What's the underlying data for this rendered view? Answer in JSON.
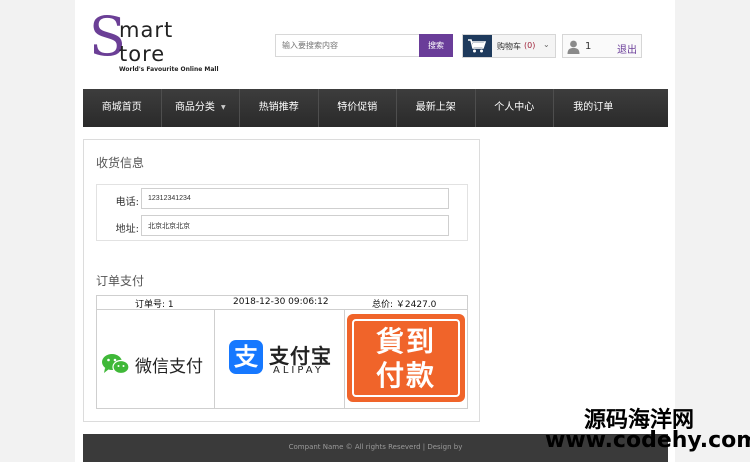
{
  "logo": {
    "s_letter": "S",
    "line1": "mart",
    "line2": "tore",
    "tagline": "World's Favourite Online Mall"
  },
  "search": {
    "placeholder": "输入要搜索内容",
    "button_label": "搜索"
  },
  "cart": {
    "label": "购物车",
    "count": "(0)",
    "icon": "cart-icon"
  },
  "user": {
    "icon": "user-icon",
    "id": "1",
    "logout_label": "退出"
  },
  "nav": {
    "items": [
      {
        "label": "商城首页"
      },
      {
        "label": "商品分类"
      },
      {
        "label": "热销推荐"
      },
      {
        "label": "特价促销"
      },
      {
        "label": "最新上架"
      },
      {
        "label": "个人中心"
      },
      {
        "label": "我的订单"
      }
    ]
  },
  "shipping": {
    "title": "收货信息",
    "phone_label": "电话:",
    "phone_value": "12312341234",
    "address_label": "地址:",
    "address_value": "北京北京北京"
  },
  "payment": {
    "title": "订单支付",
    "order_no": "订单号: 1",
    "datetime": "2018-12-30 09:06:12",
    "total": "总价: ￥2427.0",
    "wechat_label": "微信支付",
    "alipay_main": "支付宝",
    "alipay_sub": "ALIPAY",
    "cod_line1": "貨到",
    "cod_line2": "付款"
  },
  "footer": {
    "text": "Compant Name © All rights Reseverd | Design by"
  },
  "watermark": {
    "line1": "源码海洋网",
    "line2": "www.codehy.com"
  },
  "colors": {
    "brand_purple": "#6a3d99",
    "nav_bg": "#333333",
    "cod_orange": "#f0642a",
    "alipay_blue": "#1678ff",
    "wechat_green": "#3fb838"
  }
}
